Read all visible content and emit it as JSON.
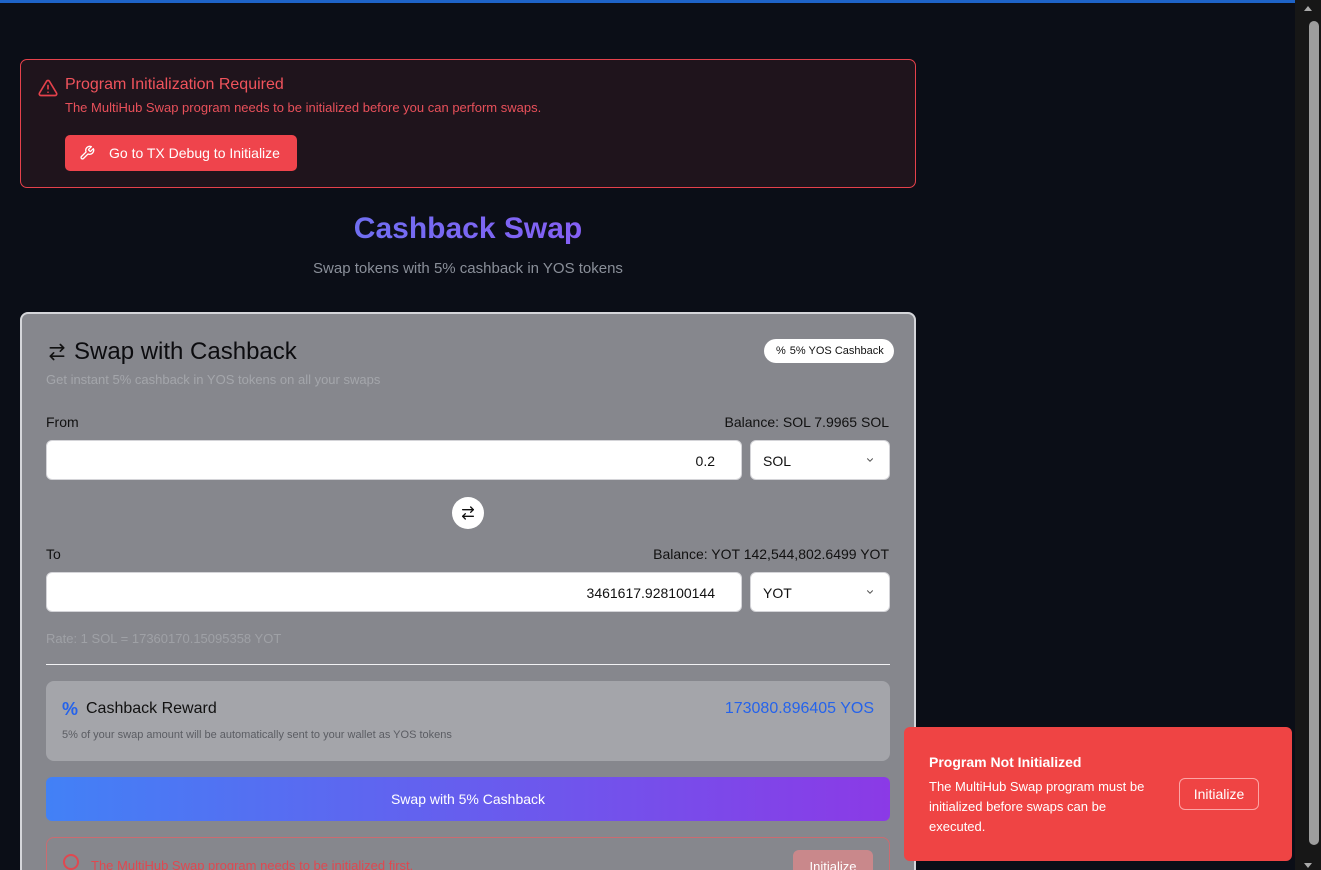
{
  "alert": {
    "title": "Program Initialization Required",
    "description": "The MultiHub Swap program needs to be initialized before you can perform swaps.",
    "button_label": "Go to TX Debug to Initialize",
    "icon": "warning-triangle-icon",
    "button_icon": "wrench-icon"
  },
  "hero": {
    "title": "Cashback Swap",
    "subtitle": "Swap tokens with 5% cashback in YOS tokens"
  },
  "card": {
    "title": "Swap with Cashback",
    "description": "Get instant 5% cashback in YOS tokens on all your swaps",
    "badge": "5% YOS Cashback",
    "badge_icon": "percent-icon",
    "title_icon": "swap-arrows-icon"
  },
  "from": {
    "label": "From",
    "balance": "Balance: SOL 7.9965 SOL",
    "amount": "0.2",
    "token": "SOL"
  },
  "to": {
    "label": "To",
    "balance": "Balance: YOT 142,544,802.6499 YOT",
    "amount": "3461617.928100144",
    "token": "YOT"
  },
  "rate": "Rate: 1 SOL = 17360170.15095358 YOT",
  "reward": {
    "title": "Cashback Reward",
    "value": "173080.896405 YOS",
    "description": "5% of your swap amount will be automatically sent to your wallet as YOS tokens"
  },
  "swap_button": "Swap with 5% Cashback",
  "error": {
    "text": "The MultiHub Swap program needs to be initialized first.",
    "button": "Initialize"
  },
  "toast": {
    "title": "Program Not Initialized",
    "description": "The MultiHub Swap program must be initialized before swaps can be executed.",
    "button": "Initialize"
  },
  "colors": {
    "accent_blue": "#2563eb",
    "danger_red": "#ef4444",
    "gradient_start": "#4281f6",
    "gradient_end": "#8b3ae6"
  }
}
